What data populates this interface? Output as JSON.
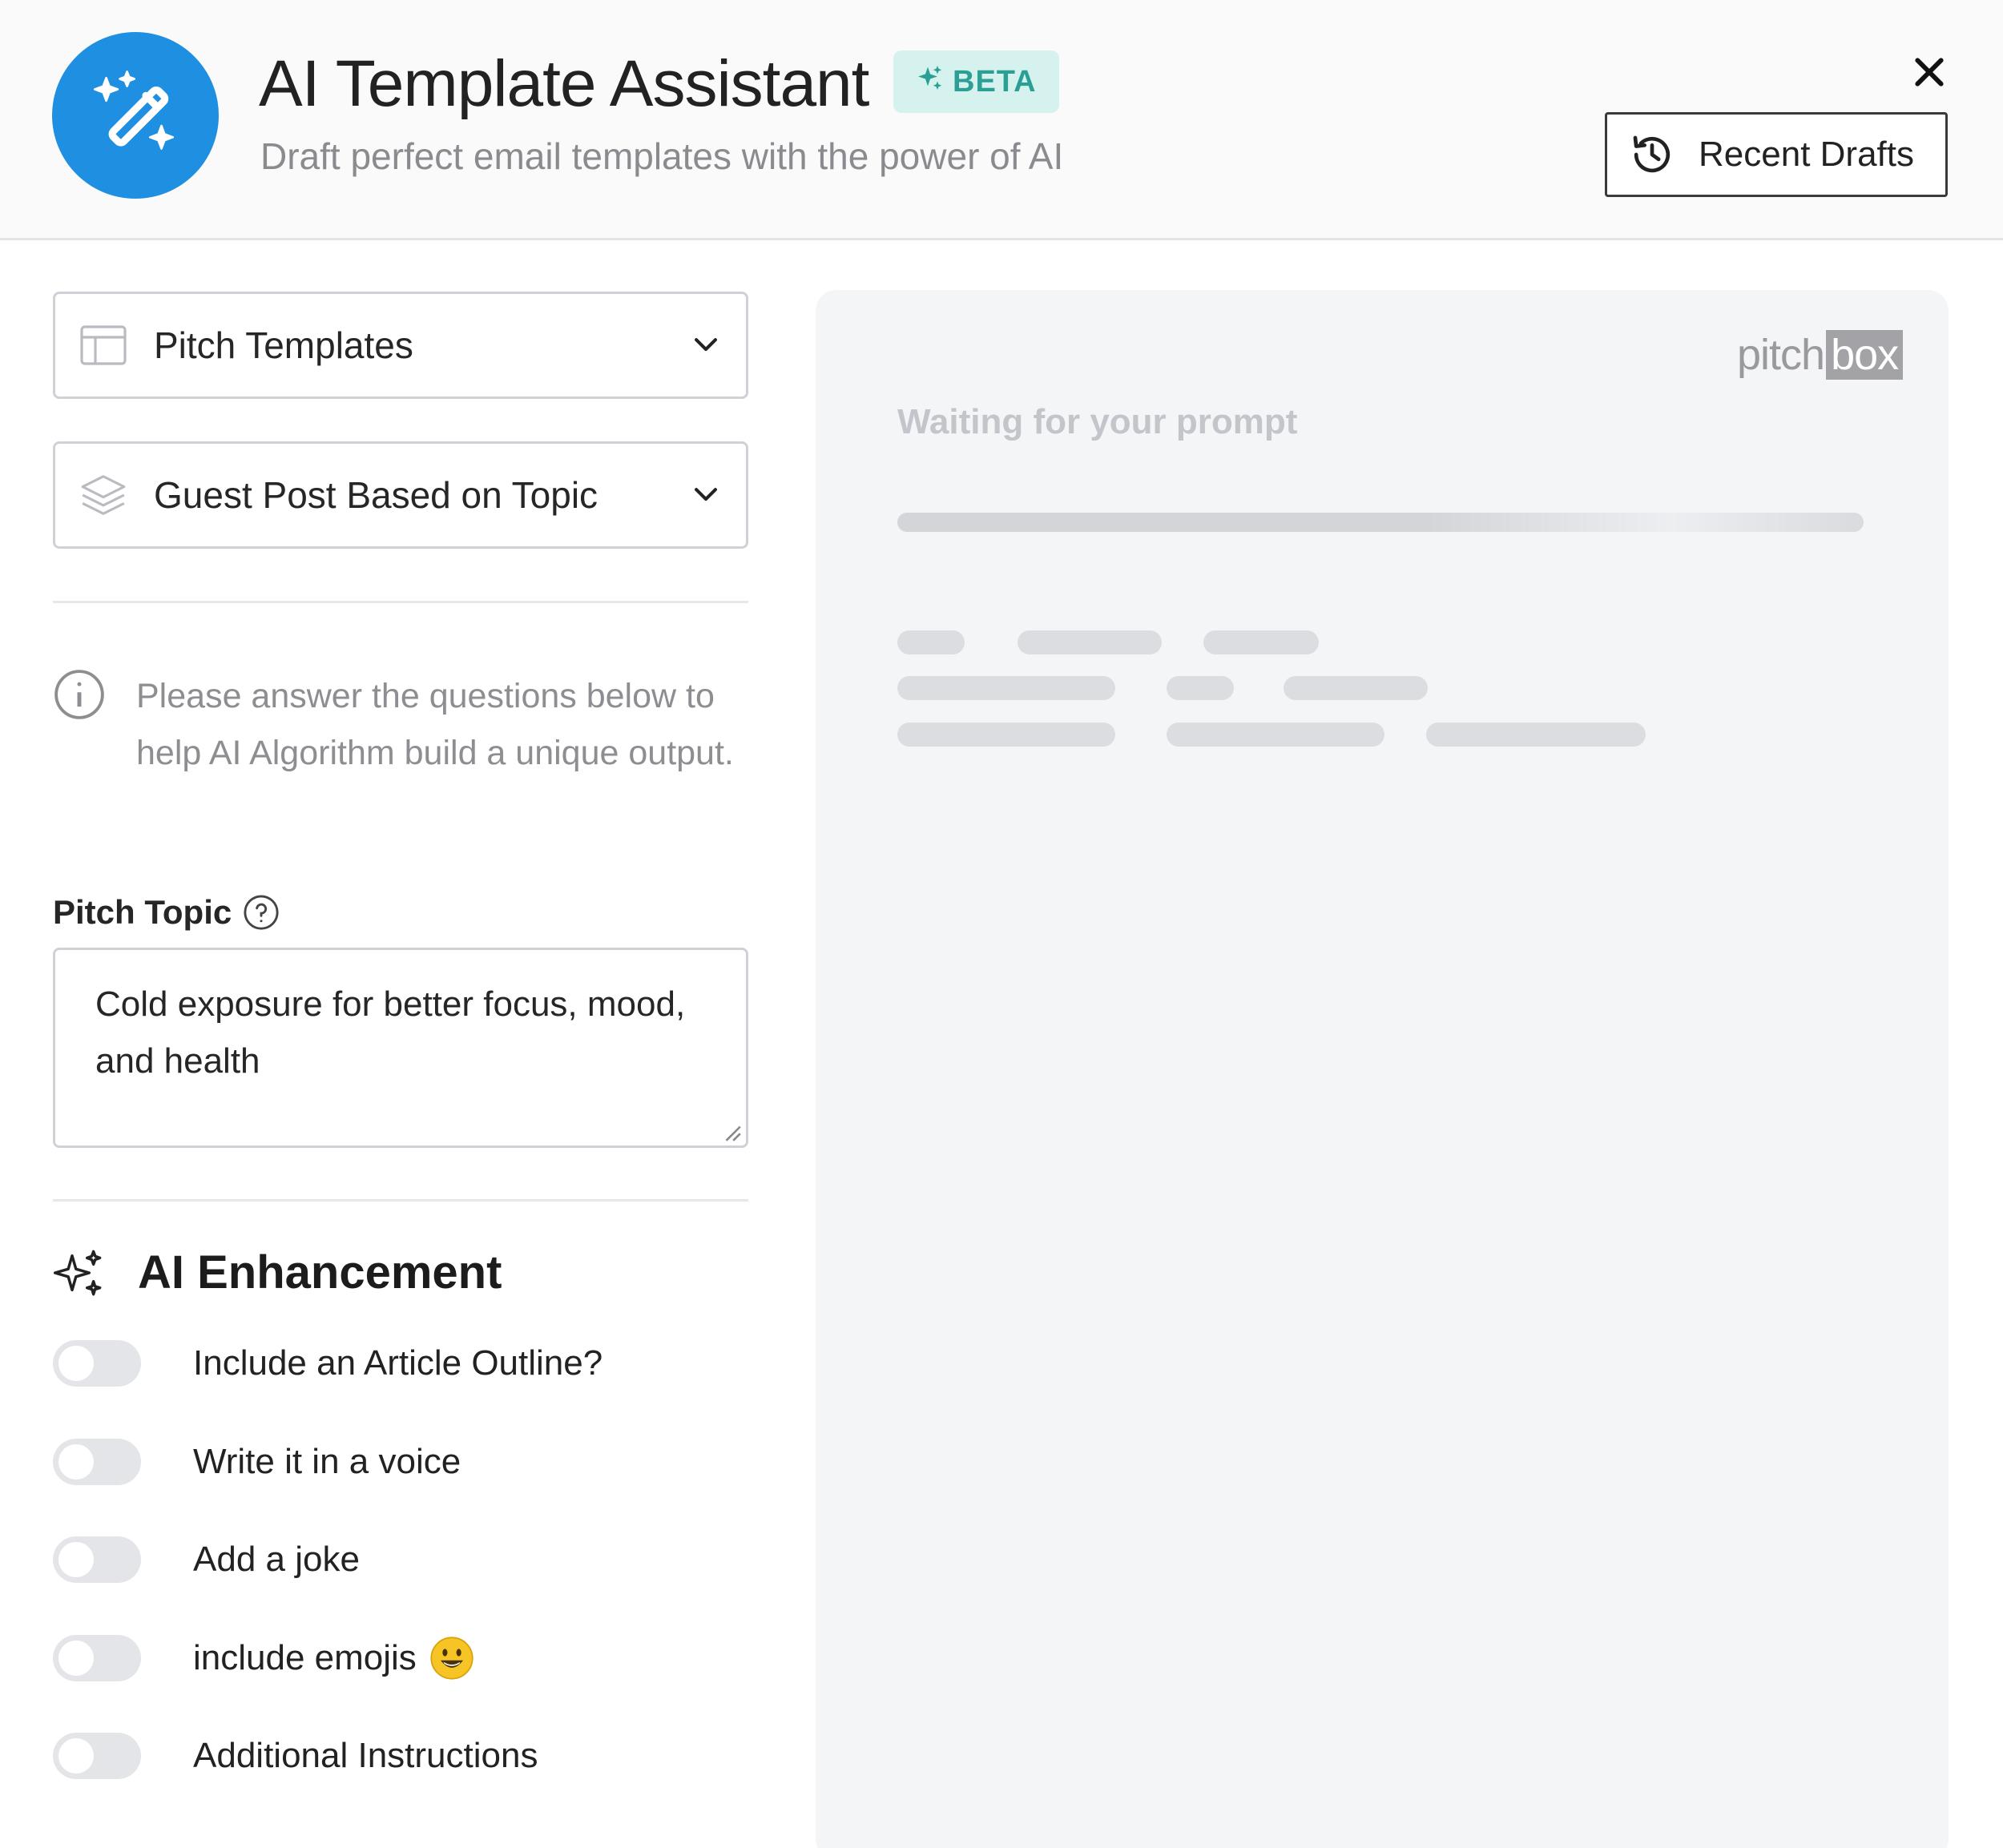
{
  "header": {
    "title": "AI Template Assistant",
    "badge": "BETA",
    "subtitle": "Draft perfect email templates with the power of AI",
    "recent_drafts_label": "Recent Drafts"
  },
  "form": {
    "template_category": {
      "selected": "Pitch Templates"
    },
    "template_type": {
      "selected": "Guest Post Based on Topic"
    },
    "info_text": "Please answer the questions below to help AI Algorithm build a unique output.",
    "pitch_topic": {
      "label": "Pitch Topic",
      "value": "Cold exposure for better focus, mood, and health"
    }
  },
  "enhancement": {
    "title": "AI Enhancement",
    "options": [
      {
        "label": "Include an Article Outline?",
        "on": false
      },
      {
        "label": "Write it in a voice",
        "on": false
      },
      {
        "label": "Add a joke",
        "on": false
      },
      {
        "label": "include emojis",
        "on": false
      },
      {
        "label": "Additional Instructions",
        "on": false
      }
    ]
  },
  "preview": {
    "brand_part1": "pitch",
    "brand_part2": "box",
    "status": "Waiting for your prompt"
  },
  "colors": {
    "accent": "#1f8fe1",
    "badge_bg": "#d6f2ee",
    "badge_text": "#2b9f93",
    "preview_bg": "#f4f5f7"
  },
  "icons": {
    "logo": "magic-wand-icon",
    "badge": "sparkles-icon",
    "close": "close-icon",
    "recent": "history-icon",
    "category": "layout-template-icon",
    "type": "layers-icon",
    "info": "info-icon",
    "help": "question-circle-icon",
    "enhancement": "sparkles-icon"
  }
}
